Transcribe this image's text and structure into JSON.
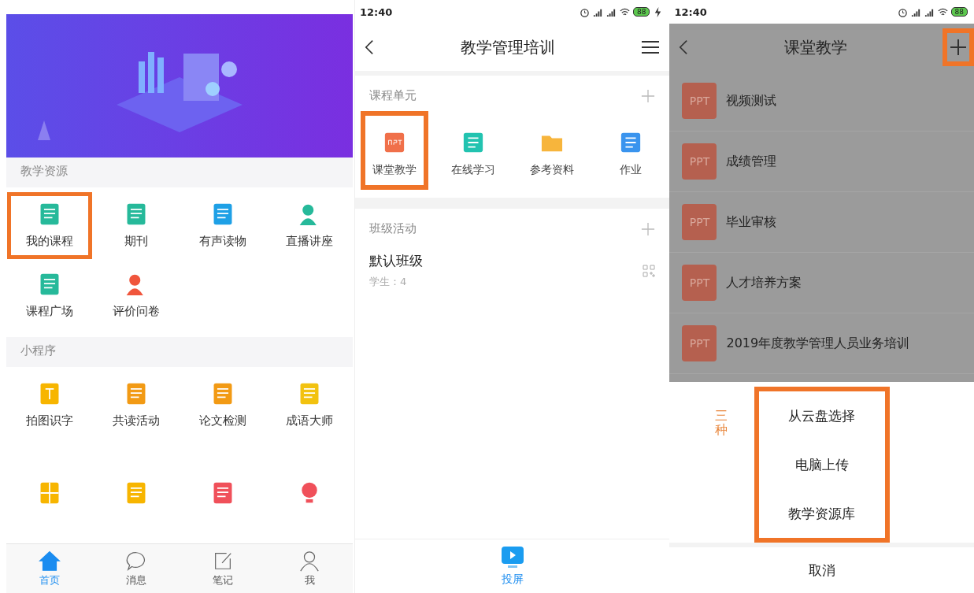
{
  "home_screen": {
    "sections": [
      {
        "title": "教学资源",
        "items": [
          {
            "label": "我的课程",
            "highlighted": true
          },
          {
            "label": "期刊",
            "highlighted": false
          },
          {
            "label": "有声读物",
            "highlighted": false
          },
          {
            "label": "直播讲座",
            "highlighted": false
          },
          {
            "label": "课程广场",
            "highlighted": false
          },
          {
            "label": "评价问卷",
            "highlighted": false
          }
        ]
      },
      {
        "title": "小程序",
        "items": [
          {
            "label": "拍图识字",
            "highlighted": false
          },
          {
            "label": "共读活动",
            "highlighted": false
          },
          {
            "label": "论文检测",
            "highlighted": false
          },
          {
            "label": "成语大师",
            "highlighted": false
          },
          {
            "highlighted": false
          },
          {
            "highlighted": false
          },
          {
            "highlighted": false
          },
          {
            "highlighted": false
          }
        ]
      }
    ],
    "tab_bar": [
      {
        "label": "首页",
        "selected": true
      },
      {
        "label": "消息",
        "selected": false
      },
      {
        "label": "笔记",
        "selected": false
      },
      {
        "label": "我",
        "selected": false
      }
    ]
  },
  "course_screen": {
    "status_bar": {
      "time": "12:40",
      "battery": "88",
      "charging": true
    },
    "title": "教学管理培训",
    "units": {
      "title": "课程单元",
      "items": [
        {
          "label": "课堂教学",
          "highlighted": true
        },
        {
          "label": "在线学习",
          "highlighted": false
        },
        {
          "label": "参考资料",
          "highlighted": false
        },
        {
          "label": "作业",
          "highlighted": false
        }
      ]
    },
    "activities": {
      "title": "班级活动",
      "class_name": "默认班级",
      "students": "学生：4"
    },
    "bottom_button": "投屏"
  },
  "lesson_screen": {
    "status_bar": {
      "time": "12:40",
      "battery": "88",
      "charging": false
    },
    "dimmed": true,
    "title": "课堂教学",
    "add_highlighted": true,
    "files": [
      {
        "badge": "PPT",
        "name": "视频测试"
      },
      {
        "badge": "PPT",
        "name": "成绩管理"
      },
      {
        "badge": "PPT",
        "name": "毕业审核"
      },
      {
        "badge": "PPT",
        "name": "人才培养方案"
      },
      {
        "badge": "PPT",
        "name": "2019年度教学管理人员业务培训"
      }
    ],
    "action_sheet": {
      "annotation": "三种",
      "options_highlighted": true,
      "options": [
        "从云盘选择",
        "电脑上传",
        "教学资源库"
      ],
      "cancel": "取消"
    }
  }
}
